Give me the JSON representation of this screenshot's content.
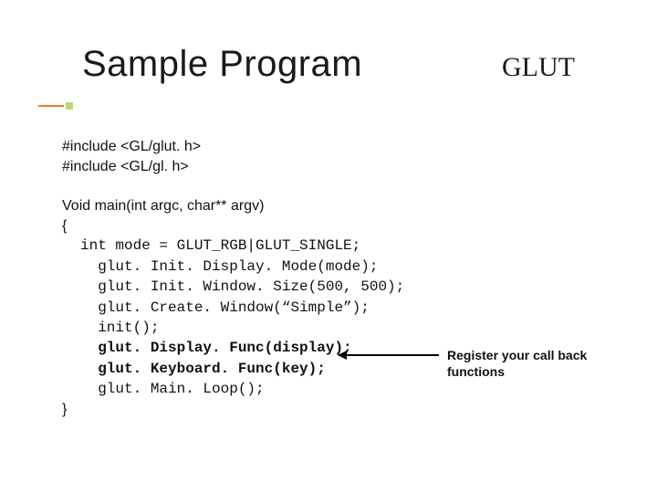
{
  "title": "Sample Program",
  "brand": "GLUT",
  "includes": [
    "#include <GL/glut. h>",
    "#include <GL/gl. h>"
  ],
  "signature": "Void main(int argc, char** argv)",
  "open_brace": "{",
  "code": {
    "line1": "int mode = GLUT_RGB|GLUT_SINGLE;",
    "line2": "glut. Init. Display. Mode(mode);",
    "line3": "glut. Init. Window. Size(500, 500);",
    "line4": "glut. Create. Window(“Simple”);",
    "line5": "init();",
    "line6": "glut. Display. Func(display);",
    "line7": "glut. Keyboard. Func(key);",
    "line8": "glut. Main. Loop();"
  },
  "close_brace": "}",
  "annotation": "Register your call back functions"
}
